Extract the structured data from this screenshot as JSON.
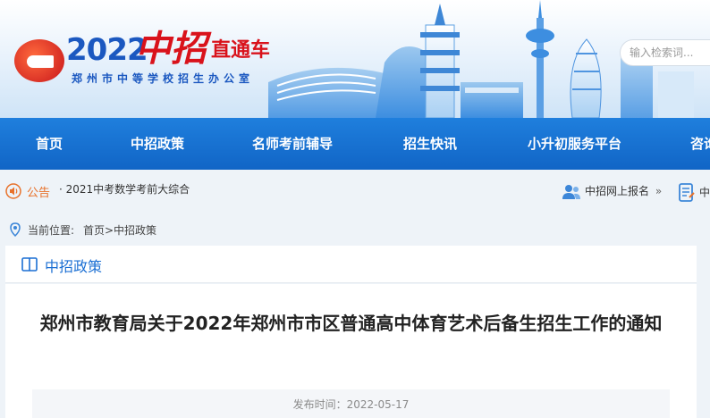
{
  "header": {
    "logo_year": "2022",
    "logo_main": "中招",
    "logo_tag": "直通车",
    "logo_subtitle": "郑州市中等学校招生办公室",
    "search_placeholder": "输入检索词..."
  },
  "nav": {
    "items": [
      {
        "label": "首页"
      },
      {
        "label": "中招政策"
      },
      {
        "label": "名师考前辅导"
      },
      {
        "label": "招生快讯"
      },
      {
        "label": "小升初服务平台"
      },
      {
        "label": "咨询"
      }
    ]
  },
  "notice": {
    "label": "公告",
    "text": "· 2021中考数学考前大综合",
    "quick_links": [
      {
        "label": "中招网上报名",
        "suffix": "»"
      },
      {
        "label": "中"
      }
    ]
  },
  "breadcrumb": {
    "label": "当前位置:",
    "path": "首页>中招政策"
  },
  "section": {
    "title": "中招政策"
  },
  "article": {
    "title": "郑州市教育局关于2022年郑州市市区普通高中体育艺术后备生招生工作的通知",
    "published": "发布时间：2022-05-17"
  },
  "colors": {
    "nav_bg": "#1a74d6",
    "accent_blue": "#1b6fd3",
    "notice_orange": "#e8712a",
    "logo_red": "#d9121b"
  }
}
